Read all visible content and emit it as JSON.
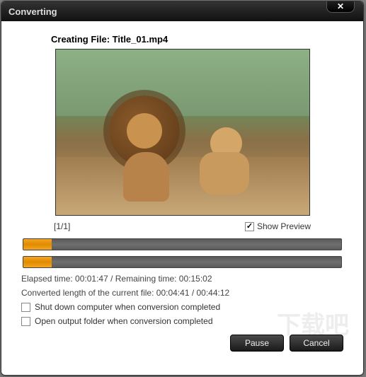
{
  "titlebar": {
    "title": "Converting",
    "close_glyph": "✕"
  },
  "file": {
    "label": "Creating File: Title_01.mp4"
  },
  "counter": "[1/1]",
  "show_preview": {
    "label": "Show Preview",
    "checked": true
  },
  "progress": {
    "overall_percent": 9,
    "file_percent": 9
  },
  "times": {
    "elapsed_remaining": "Elapsed time:  00:01:47 / Remaining time:  00:15:02",
    "converted_length": "Converted length of the current file:  00:04:41 / 00:44:12"
  },
  "options": {
    "shutdown": {
      "label": "Shut down computer when conversion completed",
      "checked": false
    },
    "open_folder": {
      "label": "Open output folder when conversion completed",
      "checked": false
    }
  },
  "buttons": {
    "pause": "Pause",
    "cancel": "Cancel"
  },
  "watermark": "下载吧"
}
